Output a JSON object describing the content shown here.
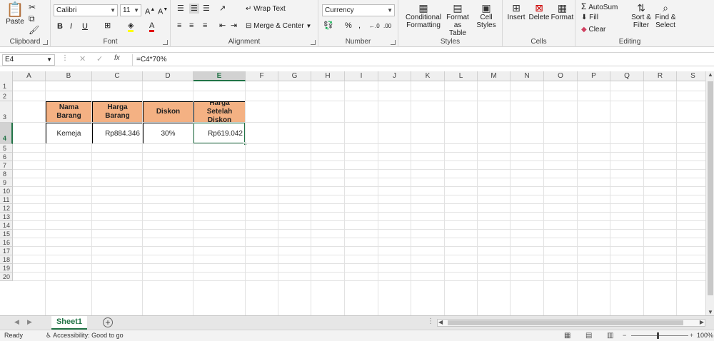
{
  "ribbon": {
    "clipboard": {
      "paste_label": "Paste",
      "group_label": "Clipboard"
    },
    "font": {
      "name": "Calibri",
      "size": "11",
      "bold": "B",
      "italic": "I",
      "underline": "U",
      "group_label": "Font"
    },
    "alignment": {
      "wrap_text": "Wrap Text",
      "merge_center": "Merge & Center",
      "group_label": "Alignment"
    },
    "number": {
      "format": "Currency",
      "group_label": "Number"
    },
    "styles": {
      "conditional": [
        "Conditional",
        "Formatting"
      ],
      "format_table": [
        "Format as",
        "Table"
      ],
      "cell_styles": [
        "Cell",
        "Styles"
      ],
      "group_label": "Styles"
    },
    "cells": {
      "insert": "Insert",
      "delete": "Delete",
      "format": "Format",
      "group_label": "Cells"
    },
    "editing": {
      "autosum": "AutoSum",
      "fill": "Fill",
      "clear": "Clear",
      "sort_filter": [
        "Sort &",
        "Filter"
      ],
      "find_select": [
        "Find &",
        "Select"
      ],
      "group_label": "Editing"
    },
    "accent": "#217346"
  },
  "formula_bar": {
    "name_box": "E4",
    "fx": "fx",
    "formula": "=C4*70%"
  },
  "columns": [
    "A",
    "B",
    "C",
    "D",
    "E",
    "F",
    "G",
    "H",
    "I",
    "J",
    "K",
    "L",
    "M",
    "N",
    "O",
    "P",
    "Q",
    "R",
    "S"
  ],
  "rows": [
    "1",
    "2",
    "3",
    "4",
    "5",
    "6",
    "7",
    "8",
    "9",
    "10",
    "11",
    "12",
    "13",
    "14",
    "15",
    "16",
    "17",
    "18",
    "19",
    "20"
  ],
  "table": {
    "headers": [
      "Nama Barang",
      "Harga Barang",
      "Diskon",
      "Harga Setelah Diskon"
    ],
    "row": [
      "Kemeja",
      "Rp884.346",
      "30%",
      "Rp619.042"
    ],
    "header_color": "#f4b183"
  },
  "sheets": {
    "active": "Sheet1"
  },
  "status": {
    "ready": "Ready",
    "accessibility": "Accessibility: Good to go",
    "zoom": "100%"
  }
}
